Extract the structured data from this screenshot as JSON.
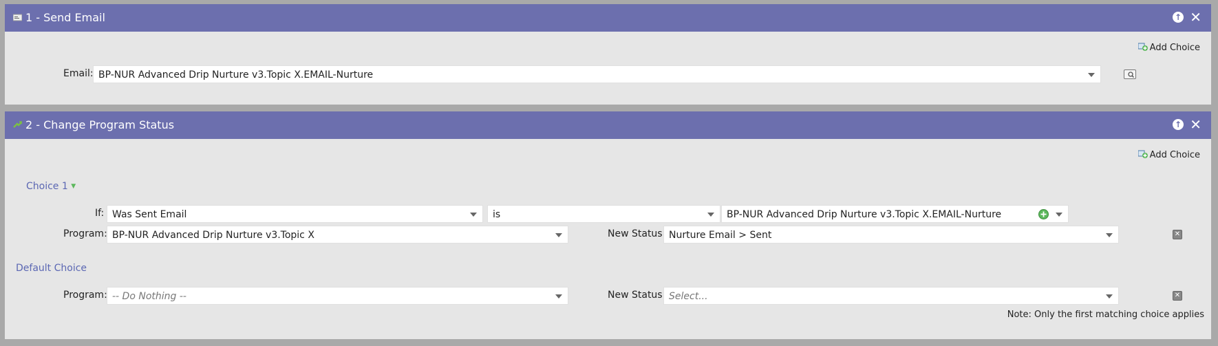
{
  "step1": {
    "title": "1 - Send Email",
    "add_choice": "Add Choice",
    "email_label": "Email:",
    "email_value": "BP-NUR Advanced Drip Nurture v3.Topic X.EMAIL-Nurture"
  },
  "step2": {
    "title": "2 - Change Program Status",
    "add_choice": "Add Choice",
    "choice1": {
      "label": "Choice 1",
      "if_label": "If:",
      "condition": "Was Sent Email",
      "operator": "is",
      "condition_value": "BP-NUR Advanced Drip Nurture v3.Topic X.EMAIL-Nurture",
      "program_label": "Program:",
      "program": "BP-NUR Advanced Drip Nurture v3.Topic X",
      "status_label": "New Status:",
      "status": "Nurture Email > Sent"
    },
    "default_choice": {
      "label": "Default Choice",
      "program_label": "Program:",
      "program_placeholder": "-- Do Nothing --",
      "status_label": "New Status:",
      "status_placeholder": "Select..."
    },
    "note": "Note: Only the first matching choice applies"
  },
  "icons": {
    "header_up": "arrow-up-circle-icon",
    "header_close": "close-icon",
    "add_choice": "add-choice-icon",
    "lookup": "lookup-icon",
    "remove": "remove-icon",
    "add_value": "plus-circle-icon"
  },
  "colors": {
    "header_bg": "#6c6fae",
    "panel_bg": "#e6e6e6",
    "link": "#5b67b3",
    "plus_green": "#5cb85c"
  }
}
